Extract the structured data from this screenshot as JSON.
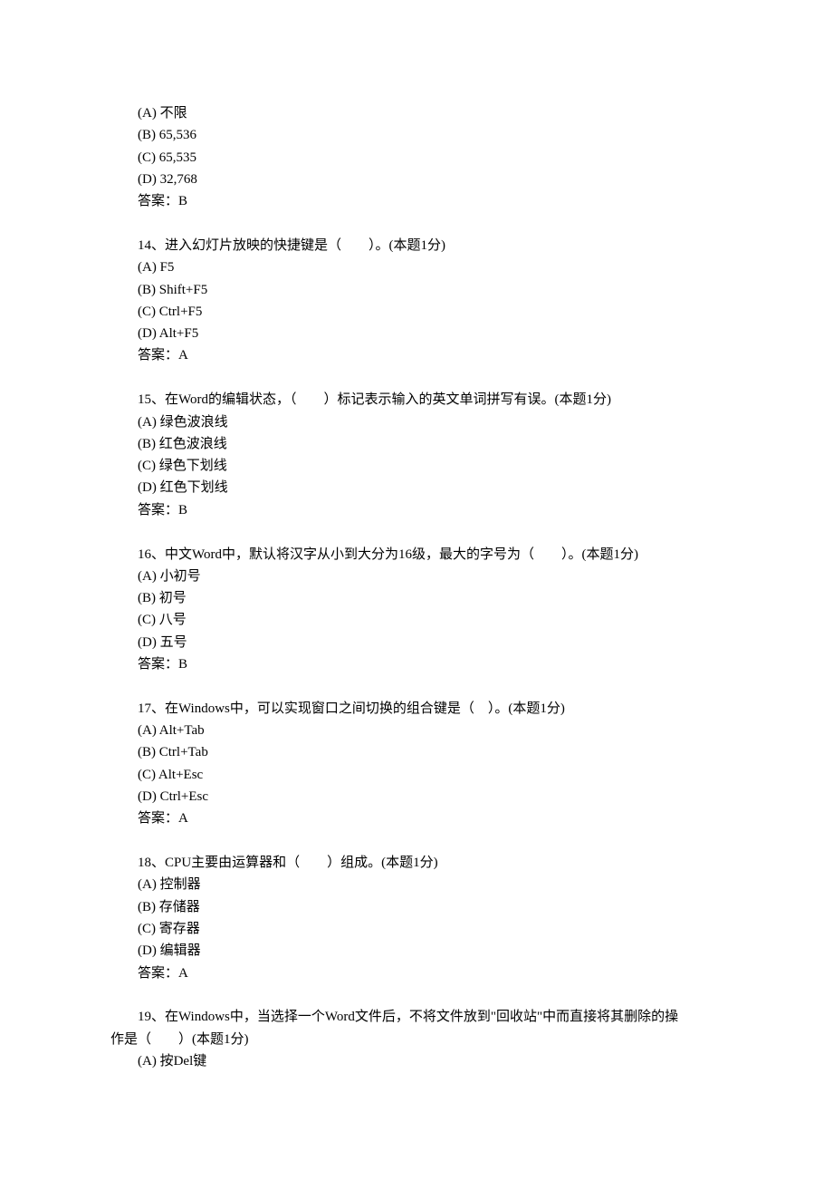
{
  "q13": {
    "options": {
      "A": "(A) 不限",
      "B": "(B) 65,536",
      "C": "(C) 65,535",
      "D": "(D) 32,768"
    },
    "answer": "答案：B"
  },
  "q14": {
    "text": "14、进入幻灯片放映的快捷键是（　　）。(本题1分)",
    "options": {
      "A": "(A) F5",
      "B": "(B) Shift+F5",
      "C": "(C) Ctrl+F5",
      "D": "(D) Alt+F5"
    },
    "answer": "答案：A"
  },
  "q15": {
    "text": "15、在Word的编辑状态，（　　）标记表示输入的英文单词拼写有误。(本题1分)",
    "options": {
      "A": "(A) 绿色波浪线",
      "B": "(B) 红色波浪线",
      "C": "(C) 绿色下划线",
      "D": "(D) 红色下划线"
    },
    "answer": "答案：B"
  },
  "q16": {
    "text": "16、中文Word中，默认将汉字从小到大分为16级，最大的字号为（　　）。(本题1分)",
    "options": {
      "A": "(A) 小初号",
      "B": "(B) 初号",
      "C": "(C) 八号",
      "D": "(D) 五号"
    },
    "answer": "答案：B"
  },
  "q17": {
    "text": "17、在Windows中，可以实现窗口之间切换的组合键是（　）。(本题1分)",
    "options": {
      "A": "(A) Alt+Tab",
      "B": "(B) Ctrl+Tab",
      "C": "(C) Alt+Esc",
      "D": "(D) Ctrl+Esc"
    },
    "answer": "答案：A"
  },
  "q18": {
    "text": "18、CPU主要由运算器和（　　）组成。(本题1分)",
    "options": {
      "A": "(A) 控制器",
      "B": "(B) 存储器",
      "C": "(C) 寄存器",
      "D": "(D) 编辑器"
    },
    "answer": "答案：A"
  },
  "q19": {
    "line1": "19、在Windows中，当选择一个Word文件后，不将文件放到\"回收站\"中而直接将其删除的操",
    "line2": "作是（　　）(本题1分)",
    "options": {
      "A": "(A) 按Del键"
    }
  }
}
